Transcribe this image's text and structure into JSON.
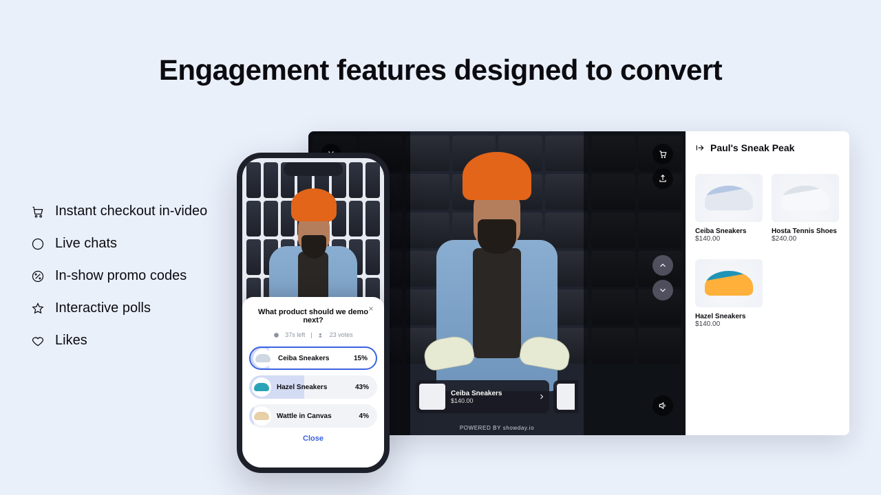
{
  "heading": "Engagement features designed to convert",
  "features": [
    {
      "label": "Instant checkout in-video"
    },
    {
      "label": "Live chats"
    },
    {
      "label": "In-show promo codes"
    },
    {
      "label": "Interactive polls"
    },
    {
      "label": "Likes"
    }
  ],
  "desktop": {
    "stream_title": "Paul's Sneak Peak",
    "powered_by": "POWERED BY showday.io",
    "featured_product": {
      "name": "Ceiba Sneakers",
      "price": "$140.00"
    },
    "products": [
      {
        "name": "Ceiba Sneakers",
        "price": "$140.00"
      },
      {
        "name": "Hosta Tennis Shoes",
        "price": "$240.00"
      },
      {
        "name": "Hazel Sneakers",
        "price": "$140.00"
      }
    ]
  },
  "poll": {
    "question": "What product should we demo next?",
    "time_left": "37s left",
    "votes": "23 votes",
    "options": [
      {
        "label": "Ceiba Sneakers",
        "pct": "15%"
      },
      {
        "label": "Hazel Sneakers",
        "pct": "43%"
      },
      {
        "label": "Wattle in Canvas",
        "pct": "4%"
      }
    ],
    "close_label": "Close"
  }
}
